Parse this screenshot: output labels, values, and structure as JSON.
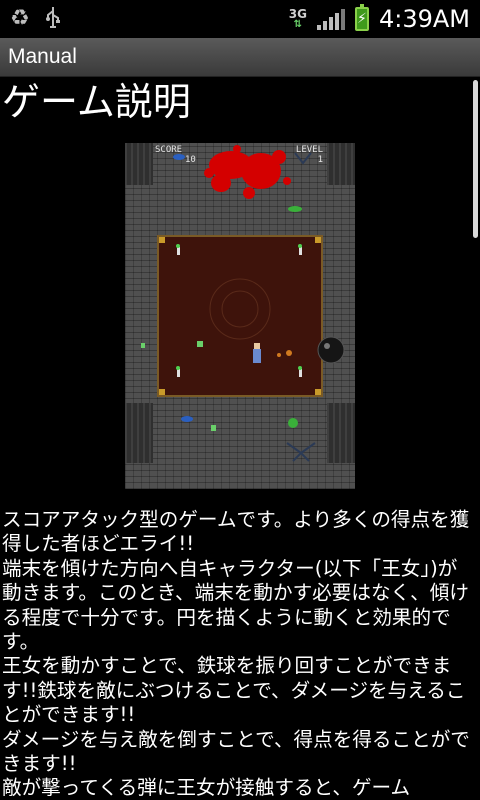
{
  "status_bar": {
    "time": "4:39AM",
    "network": "3G",
    "icons": [
      "recycle-icon",
      "usb-icon",
      "network-3g-icon",
      "signal-icon",
      "battery-charging-icon"
    ]
  },
  "title_bar": {
    "title": "Manual"
  },
  "content": {
    "heading": "ゲーム説明",
    "game_screenshot": {
      "hud_score_label": "SCORE",
      "hud_score_value": "10",
      "hud_level_label": "LEVEL",
      "hud_level_value": "1"
    },
    "paragraphs": [
      "スコアアタック型のゲームです。より多くの得点を獲得した者ほどエライ!!",
      "端末を傾けた方向へ自キャラクター(以下「王女」)が動きます。このとき、端末を動かす必要はなく、傾ける程度で十分です。円を描くように動くと効果的です。",
      "王女を動かすことで、鉄球を振り回すことができます!!鉄球を敵にぶつけることで、ダメージを与えることができます!!",
      "ダメージを与え敵を倒すことで、得点を得ることができます!!",
      "敵が撃ってくる弾に王女が接触すると、ゲーム"
    ]
  },
  "colors": {
    "title_bar": "#4a4a4a",
    "background": "#000000",
    "arena": "#3e130b",
    "blood": "#d40000",
    "battery": "#3f9a1b"
  }
}
